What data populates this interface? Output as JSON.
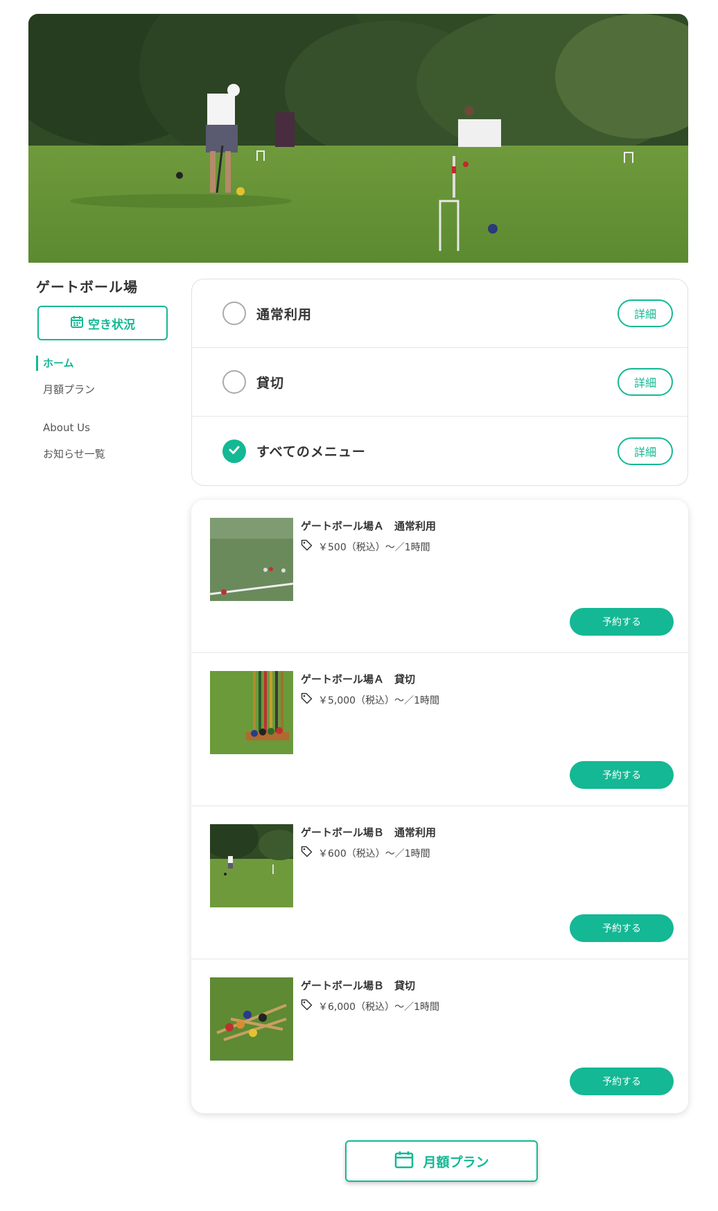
{
  "sidebar": {
    "title": "ゲートボール場",
    "availability_label": "空き状況",
    "nav": {
      "home": "ホーム",
      "monthly": "月額プラン",
      "about": "About Us",
      "news": "お知らせ一覧"
    }
  },
  "filters": [
    {
      "label": "通常利用",
      "detail": "詳細",
      "checked": false
    },
    {
      "label": "貸切",
      "detail": "詳細",
      "checked": false
    },
    {
      "label": "すべてのメニュー",
      "detail": "詳細",
      "checked": true
    }
  ],
  "menu_items": [
    {
      "title": "ゲートボール場Ａ　通常利用",
      "price": "￥500（税込）〜／1時間",
      "button": "予約する"
    },
    {
      "title": "ゲートボール場Ａ　貸切",
      "price": "￥5,000（税込）〜／1時間",
      "button": "予約する"
    },
    {
      "title": "ゲートボール場Ｂ　通常利用",
      "price": "￥600（税込）〜／1時間",
      "button": "予約する"
    },
    {
      "title": "ゲートボール場Ｂ　貸切",
      "price": "￥6,000（税込）〜／1時間",
      "button": "予約する"
    }
  ],
  "monthly_button": "月額プラン",
  "colors": {
    "accent": "#14b894",
    "text": "#333333",
    "border": "#e0e0e0"
  },
  "icons": {
    "calendar": "calendar-icon",
    "check": "check-icon",
    "tag": "price-tag-icon"
  }
}
